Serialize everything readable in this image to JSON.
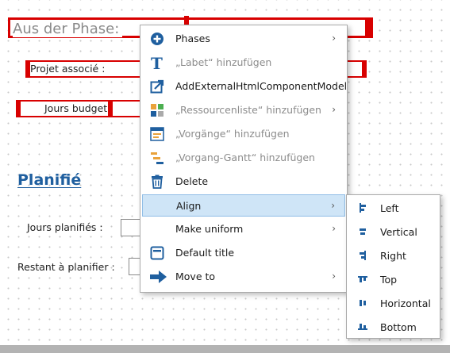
{
  "form": {
    "phase_label": "Aus der Phase:",
    "projet_label": "Projet associé :",
    "jours_budget_label": "Jours budget :",
    "section_title": "Planifié",
    "jours_planifies_label": "Jours planifiés :",
    "restant_label": "Restant à planifier :"
  },
  "context_menu": {
    "items": [
      {
        "label": "Phases",
        "icon": "plus-circle-icon",
        "submenu": true,
        "disabled": false
      },
      {
        "label": "„Labet“ hinzufügen",
        "icon": "text-T-icon",
        "submenu": false,
        "disabled": true
      },
      {
        "label": "AddExternalHtmlComponentModel",
        "icon": "external-link-icon",
        "submenu": false,
        "disabled": false
      },
      {
        "label": "„Ressourcenliste“ hinzufügen",
        "icon": "resource-grid-icon",
        "submenu": true,
        "disabled": true
      },
      {
        "label": "„Vorgänge“ hinzufügen",
        "icon": "task-list-icon",
        "submenu": false,
        "disabled": true
      },
      {
        "label": "„Vorgang-Gantt“ hinzufügen",
        "icon": "gantt-icon",
        "submenu": false,
        "disabled": true
      },
      {
        "label": "Delete",
        "icon": "trash-icon",
        "submenu": false,
        "disabled": false
      },
      {
        "label": "Align",
        "icon": "",
        "submenu": true,
        "disabled": false,
        "highlighted": true
      },
      {
        "label": "Make uniform",
        "icon": "",
        "submenu": true,
        "disabled": false
      },
      {
        "label": "Default title",
        "icon": "title-box-icon",
        "submenu": false,
        "disabled": false
      },
      {
        "label": "Move to",
        "icon": "arrow-right-icon",
        "submenu": true,
        "disabled": false
      }
    ],
    "submenu_arrow": "›"
  },
  "align_submenu": {
    "items": [
      {
        "label": "Left",
        "icon": "align-left-icon"
      },
      {
        "label": "Vertical",
        "icon": "align-vertical-icon"
      },
      {
        "label": "Right",
        "icon": "align-right-icon"
      },
      {
        "label": "Top",
        "icon": "align-top-icon"
      },
      {
        "label": "Horizontal",
        "icon": "align-horizontal-icon"
      },
      {
        "label": "Bottom",
        "icon": "align-bottom-icon"
      }
    ]
  },
  "colors": {
    "selection_red": "#d80000",
    "accent_blue": "#1f5f9f",
    "highlight": "#cfe5f7"
  }
}
